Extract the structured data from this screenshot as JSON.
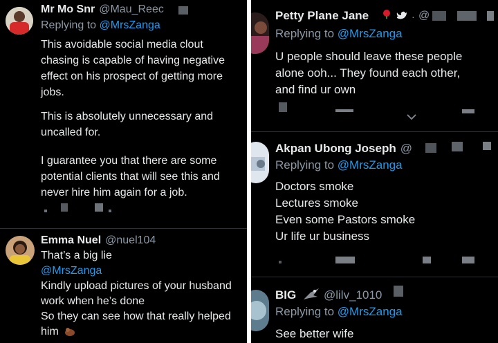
{
  "left": {
    "tweet1": {
      "name": "Mr Mo Snr",
      "handle": "@Mau_Reec",
      "replying_prefix": "Replying to",
      "replying_handle": "@MrsZanga",
      "lines": [
        "This avoidable social media clout",
        "chasing is capable of having negative",
        "effect on his prospect of getting more",
        "jobs.",
        "This is absolutely unnecessary and",
        "uncalled for.",
        "I guarantee you that there are some",
        "potential clients that will see this and",
        "never hire him again for a job."
      ]
    },
    "tweet2": {
      "name": "Emma Nuel",
      "handle": "@nuel104",
      "lines": [
        "That’s a big lie",
        "@MrsZanga",
        "Kindly upload pictures of your husband",
        "work when he’s done",
        "So they can see how that really helped",
        "him"
      ]
    }
  },
  "right": {
    "tweet1": {
      "name": "Petty Plane Jane",
      "handle": "@",
      "replying_prefix": "Replying to",
      "replying_handle": "@MrsZanga",
      "lines": [
        "U people should leave these people",
        "alone ooh... They found each other,",
        "and find ur own"
      ]
    },
    "tweet2": {
      "name": "Akpan Ubong Joseph",
      "handle": "@",
      "replying_prefix": "Replying to",
      "replying_handle": "@MrsZanga",
      "lines": [
        "Doctors smoke",
        "Lectures smoke",
        "Even some Pastors smoke",
        "Ur life ur business"
      ]
    },
    "tweet3": {
      "name": "BIG",
      "handle": "@lilv_1010",
      "replying_prefix": "Replying to",
      "replying_handle": "@MrsZanga",
      "lines": [
        "See better wife"
      ]
    }
  },
  "colors": {
    "background": "#000000",
    "text": "#e7e9ea",
    "muted": "#8b98a5",
    "link": "#1d9bf0",
    "divider": "#2f3336"
  }
}
